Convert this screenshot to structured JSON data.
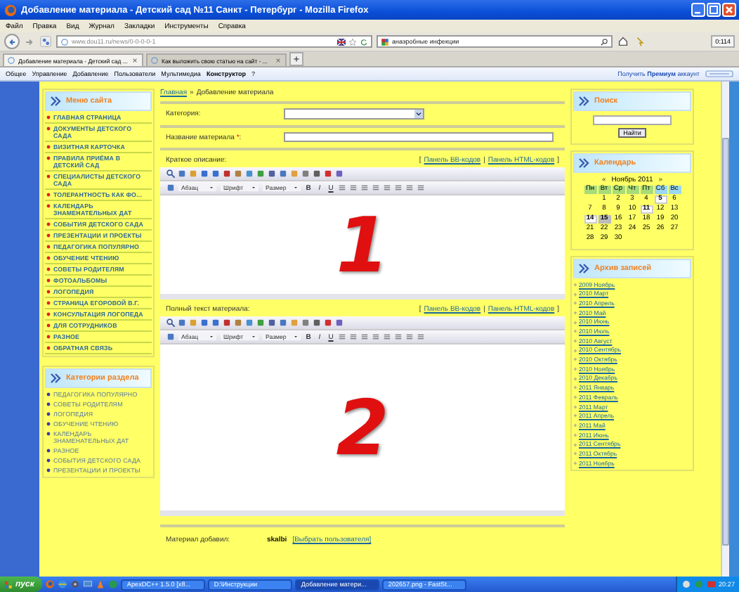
{
  "window": {
    "title": "Добавление материала - Детский сад №11 Санкт - Петербург - Mozilla Firefox"
  },
  "menu": [
    "Файл",
    "Правка",
    "Вид",
    "Журнал",
    "Закладки",
    "Инструменты",
    "Справка"
  ],
  "address": {
    "value": "www.dou11.ru/news/0-0-0-0-1"
  },
  "search": {
    "value": "анаэробные инфекции"
  },
  "counter": "0:114",
  "tabs": [
    {
      "label": "Добавление материала - Детский сад ...",
      "selected": true
    },
    {
      "label": "Как выложить свою статью на сайт - ...",
      "selected": false
    }
  ],
  "panel": {
    "items": [
      {
        "label": "Общее",
        "bold": false
      },
      {
        "label": "Управление",
        "bold": false
      },
      {
        "label": "Добавление",
        "bold": false
      },
      {
        "label": "Пользователи",
        "bold": false
      },
      {
        "label": "Мультимедиа",
        "bold": false
      },
      {
        "label": "Конструктор",
        "bold": true
      },
      {
        "label": "?",
        "bold": false
      }
    ],
    "promo": "Получить **Премиум** аккаунт"
  },
  "site_menu": {
    "title": "Меню сайта",
    "items": [
      "ГЛАВНАЯ СТРАНИЦА",
      "ДОКУМЕНТЫ ДЕТСКОГО САДА",
      "ВИЗИТНАЯ КАРТОЧКА",
      "ПРАВИЛА ПРИЁМА В ДЕТСКИЙ САД",
      "СПЕЦИАЛИСТЫ ДЕТСКОГО САДА",
      "ТОЛЕРАНТНОСТЬ КАК ФО...",
      "КАЛЕНДАРЬ ЗНАМЕНАТЕЛЬНЫХ ДАТ",
      "СОБЫТИЯ ДЕТСКОГО САДА",
      "ПРЕЗЕНТАЦИИ И ПРОЕКТЫ",
      "ПЕДАГОГИКА ПОПУЛЯРНО",
      "ОБУЧЕНИЕ ЧТЕНИЮ",
      "СОВЕТЫ РОДИТЕЛЯМ",
      "ФОТОАЛЬБОМЫ",
      "ЛОГОПЕДИЯ",
      "СТРАНИЦА ЕГОРОВОЙ В.Г.",
      "КОНСУЛЬТАЦИЯ ЛОГОПЕДА",
      "ДЛЯ СОТРУДНИКОВ",
      "РАЗНОЕ",
      "ОБРАТНАЯ СВЯЗЬ"
    ]
  },
  "categories": {
    "title": "Категории раздела",
    "items": [
      "ПЕДАГОГИКА ПОПУЛЯРНО",
      "СОВЕТЫ РОДИТЕЛЯМ",
      "ЛОГОПЕДИЯ",
      "ОБУЧЕНИЕ ЧТЕНИЮ",
      "КАЛЕНДАРЬ ЗНАМЕНАТЕЛЬНЫХ ДАТ",
      "РАЗНОЕ",
      "СОБЫТИЯ ДЕТСКОГО САДА",
      "ПРЕЗЕНТАЦИИ И ПРОЕКТЫ"
    ]
  },
  "breadcrumb": {
    "link": "Главная",
    "separator": "»",
    "current": "Добавление материала"
  },
  "form": {
    "category_label": "Категория:",
    "title_label": "Название материала",
    "required_mark": "*",
    "title_suffix": ":"
  },
  "editors": [
    {
      "label": "Краткое описание:",
      "annotation": "1",
      "links": {
        "open": "[",
        "bb": "Панель BB-кодов",
        "divider": "|",
        "html": "Панель HTML-кодов",
        "close": "]"
      },
      "dropdowns": [
        "Абзац",
        "Шрифт",
        "Размер"
      ],
      "format_buttons": [
        "B",
        "I",
        "U"
      ]
    },
    {
      "label": "Полный текст материала:",
      "annotation": "2",
      "links": {
        "open": "[",
        "bb": "Панель BB-кодов",
        "divider": "|",
        "html": "Панель HTML-кодов",
        "close": "]"
      },
      "dropdowns": [
        "Абзац",
        "Шрифт",
        "Размер"
      ],
      "format_buttons": [
        "B",
        "I",
        "U"
      ]
    }
  ],
  "author": {
    "label": "Материал добавил:",
    "name": "skalbi",
    "link": "[Выбрать пользователя]"
  },
  "search_block": {
    "title": "Поиск",
    "button": "Найти"
  },
  "calendar": {
    "title": "Календарь",
    "prev": "«",
    "month": "Ноябрь 2011",
    "next": "»",
    "weekdays": [
      {
        "label": "Пн",
        "weekend": false
      },
      {
        "label": "Вт",
        "weekend": false
      },
      {
        "label": "Ср",
        "weekend": false
      },
      {
        "label": "Чт",
        "weekend": false
      },
      {
        "label": "Пт",
        "weekend": false
      },
      {
        "label": "Сб",
        "weekend": true
      },
      {
        "label": "Вс",
        "weekend": true
      }
    ],
    "weeks": [
      [
        {
          "label": "1",
          "marked": false,
          "today": false
        },
        {
          "label": "2",
          "marked": false,
          "today": false
        },
        {
          "label": "3",
          "marked": false,
          "today": false
        },
        {
          "label": "4",
          "marked": false,
          "today": false
        },
        {
          "label": "5",
          "marked": true,
          "today": false
        },
        {
          "label": "6",
          "marked": false,
          "today": false
        }
      ],
      [
        {
          "label": "7",
          "marked": false,
          "today": false
        },
        {
          "label": "8",
          "marked": false,
          "today": false
        },
        {
          "label": "9",
          "marked": false,
          "today": false
        },
        {
          "label": "10",
          "marked": false,
          "today": false
        },
        {
          "label": "11",
          "marked": true,
          "today": false
        },
        {
          "label": "12",
          "marked": false,
          "today": false
        },
        {
          "label": "13",
          "marked": false,
          "today": false
        }
      ],
      [
        {
          "label": "14",
          "marked": true,
          "today": false
        },
        {
          "label": "15",
          "marked": false,
          "today": true
        },
        {
          "label": "16",
          "marked": false,
          "today": false
        },
        {
          "label": "17",
          "marked": false,
          "today": false
        },
        {
          "label": "18",
          "marked": false,
          "today": false
        },
        {
          "label": "19",
          "marked": false,
          "today": false
        },
        {
          "label": "20",
          "marked": false,
          "today": false
        }
      ],
      [
        {
          "label": "21",
          "marked": false,
          "today": false
        },
        {
          "label": "22",
          "marked": false,
          "today": false
        },
        {
          "label": "23",
          "marked": false,
          "today": false
        },
        {
          "label": "24",
          "marked": false,
          "today": false
        },
        {
          "label": "25",
          "marked": false,
          "today": false
        },
        {
          "label": "26",
          "marked": false,
          "today": false
        },
        {
          "label": "27",
          "marked": false,
          "today": false
        }
      ],
      [
        {
          "label": "28",
          "marked": false,
          "today": false
        },
        {
          "label": "29",
          "marked": false,
          "today": false
        },
        {
          "label": "30",
          "marked": false,
          "today": false
        }
      ]
    ]
  },
  "archive": {
    "title": "Архив записей",
    "items": [
      "2009 Ноябрь",
      "2010 Март",
      "2010 Апрель",
      "2010 Май",
      "2010 Июнь",
      "2010 Июль",
      "2010 Август",
      "2010 Сентябрь",
      "2010 Октябрь",
      "2010 Ноябрь",
      "2010 Декабрь",
      "2011 Январь",
      "2011 Февраль",
      "2011 Март",
      "2011 Апрель",
      "2011 Май",
      "2011 Июнь",
      "2011 Сентябрь",
      "2011 Октябрь",
      "2011 Ноябрь"
    ]
  },
  "taskbar": {
    "start": "пуск",
    "tasks": [
      {
        "label": "ApexDC++ 1.5.0 [x8...",
        "selected": false
      },
      {
        "label": "D:\\Инструкции",
        "selected": false
      },
      {
        "label": "Добавление матери...",
        "selected": true
      },
      {
        "label": "202657.png - FastSt...",
        "selected": false
      }
    ],
    "clock": "20:27"
  }
}
